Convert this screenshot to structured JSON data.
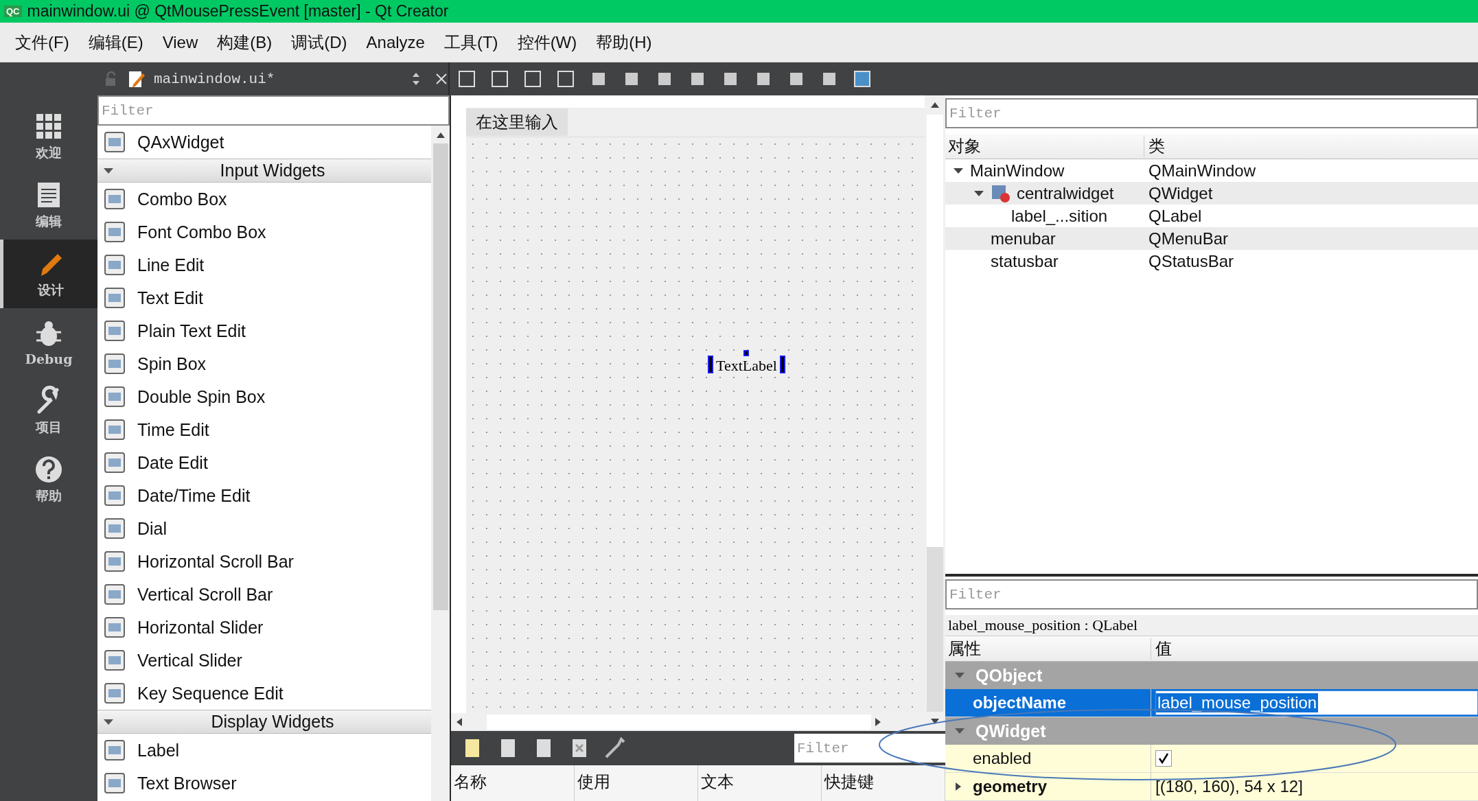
{
  "window": {
    "title": "mainwindow.ui @ QtMousePressEvent [master] - Qt Creator",
    "badge": "QC"
  },
  "menu": [
    "文件(F)",
    "编辑(E)",
    "View",
    "构建(B)",
    "调试(D)",
    "Analyze",
    "工具(T)",
    "控件(W)",
    "帮助(H)"
  ],
  "mode_bar": [
    {
      "label": "欢迎",
      "selected": false
    },
    {
      "label": "编辑",
      "selected": false
    },
    {
      "label": "设计",
      "selected": true
    },
    {
      "label": "Debug",
      "selected": false
    },
    {
      "label": "项目",
      "selected": false
    },
    {
      "label": "帮助",
      "selected": false
    }
  ],
  "editor_tab": {
    "file": "mainwindow.ui*"
  },
  "widget_box": {
    "filter_placeholder": "Filter",
    "items": [
      {
        "kind": "item",
        "label": "QAxWidget"
      },
      {
        "kind": "category",
        "label": "Input Widgets",
        "expanded": true
      },
      {
        "kind": "item",
        "label": "Combo Box"
      },
      {
        "kind": "item",
        "label": "Font Combo Box"
      },
      {
        "kind": "item",
        "label": "Line Edit"
      },
      {
        "kind": "item",
        "label": "Text Edit"
      },
      {
        "kind": "item",
        "label": "Plain Text Edit"
      },
      {
        "kind": "item",
        "label": "Spin Box"
      },
      {
        "kind": "item",
        "label": "Double Spin Box"
      },
      {
        "kind": "item",
        "label": "Time Edit"
      },
      {
        "kind": "item",
        "label": "Date Edit"
      },
      {
        "kind": "item",
        "label": "Date/Time Edit"
      },
      {
        "kind": "item",
        "label": "Dial"
      },
      {
        "kind": "item",
        "label": "Horizontal Scroll Bar"
      },
      {
        "kind": "item",
        "label": "Vertical Scroll Bar"
      },
      {
        "kind": "item",
        "label": "Horizontal Slider"
      },
      {
        "kind": "item",
        "label": "Vertical Slider"
      },
      {
        "kind": "item",
        "label": "Key Sequence Edit"
      },
      {
        "kind": "category",
        "label": "Display Widgets",
        "expanded": true
      },
      {
        "kind": "item",
        "label": "Label"
      },
      {
        "kind": "item",
        "label": "Text Browser"
      }
    ]
  },
  "canvas": {
    "menu_placeholder": "在这里输入",
    "label": "TextLabel"
  },
  "action_editor": {
    "filter_placeholder": "Filter",
    "columns": [
      "名称",
      "使用",
      "文本",
      "快捷键"
    ]
  },
  "object_inspector": {
    "filter_placeholder": "Filter",
    "columns": [
      "对象",
      "类"
    ],
    "tree": [
      {
        "name": "MainWindow",
        "class": "QMainWindow",
        "expanded": true,
        "children": [
          {
            "name": "centralwidget",
            "class": "QWidget",
            "expanded": true,
            "children": [
              {
                "name": "label_...sition",
                "class": "QLabel"
              }
            ]
          },
          {
            "name": "menubar",
            "class": "QMenuBar"
          },
          {
            "name": "statusbar",
            "class": "QStatusBar"
          }
        ]
      }
    ]
  },
  "property_editor": {
    "filter_placeholder": "Filter",
    "selection": "label_mouse_position : QLabel",
    "columns": [
      "属性",
      "值"
    ],
    "groups": [
      {
        "name": "QObject",
        "expanded": true,
        "properties": [
          {
            "kind": "text",
            "name": "objectName",
            "value": "label_mouse_position",
            "selected": true,
            "modified": true
          }
        ]
      },
      {
        "name": "QWidget",
        "expanded": true,
        "properties": [
          {
            "kind": "checkbox",
            "name": "enabled",
            "checked": true,
            "selected": false,
            "modified": false
          },
          {
            "kind": "text",
            "name": "geometry",
            "value": "[(180, 160), 54 x 12]",
            "selected": false,
            "modified": true,
            "expanded": false
          }
        ]
      }
    ]
  }
}
